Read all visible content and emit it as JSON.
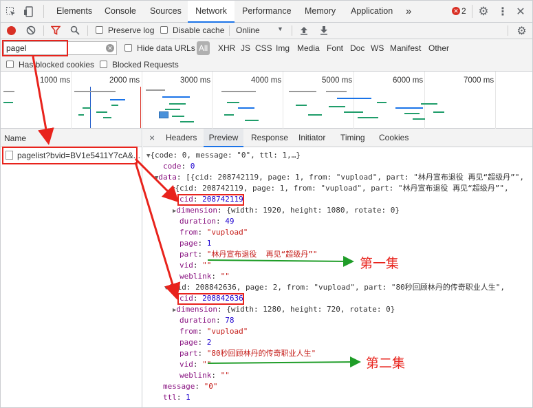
{
  "tabs": {
    "elements": "Elements",
    "console": "Console",
    "sources": "Sources",
    "network": "Network",
    "performance": "Performance",
    "memory": "Memory",
    "application": "Application",
    "more": "»",
    "error_count": "2"
  },
  "toolbar": {
    "preserve_log": "Preserve log",
    "disable_cache": "Disable cache",
    "throttle": "Online"
  },
  "filter": {
    "value": "pagel",
    "hide_data_urls": "Hide data URLs",
    "types": [
      "All",
      "XHR",
      "JS",
      "CSS",
      "Img",
      "Media",
      "Font",
      "Doc",
      "WS",
      "Manifest",
      "Other"
    ],
    "has_blocked_cookies": "Has blocked cookies",
    "blocked_requests": "Blocked Requests"
  },
  "timeline": {
    "ticks": [
      "1000 ms",
      "2000 ms",
      "3000 ms",
      "4000 ms",
      "5000 ms",
      "6000 ms",
      "7000 ms"
    ]
  },
  "requests": {
    "name_header": "Name",
    "items": [
      "pagelist?bvid=BV1e5411Y7cA&..."
    ]
  },
  "detail_tabs": {
    "close": "×",
    "headers": "Headers",
    "preview": "Preview",
    "response": "Response",
    "initiator": "Initiator",
    "timing": "Timing",
    "cookies": "Cookies"
  },
  "preview": {
    "root": "{code: 0, message: \"0\", ttl: 1,…}",
    "code_key": "code",
    "code_val": "0",
    "data_key": "data",
    "data_summary": "[{cid: 208742119, page: 1, from: \"vupload\", part: \"林丹宣布退役 再见“超级丹”\",",
    "item0_summary": "{cid: 208742119, page: 1, from: \"vupload\", part: \"林丹宣布退役 再见“超级丹”\", ",
    "item0": {
      "cid_key": "cid",
      "cid_val": "208742119",
      "dimension_key": "dimension",
      "dimension_val": "{width: 1920, height: 1080, rotate: 0}",
      "duration_key": "duration",
      "duration_val": "49",
      "from_key": "from",
      "from_val": "\"vupload\"",
      "page_key": "page",
      "page_val": "1",
      "part_key": "part",
      "part_val": "\"林丹宣布退役  再见“超级丹”\"",
      "vid_key": "vid",
      "vid_val": "\"\"",
      "weblink_key": "weblink",
      "weblink_val": "\"\""
    },
    "item1_summary": "{cid: 208842636, page: 2, from: \"vupload\", part: \"80秒回顾林丹的传奇职业人生\",",
    "item1": {
      "cid_key": "cid",
      "cid_val": "208842636",
      "dimension_key": "dimension",
      "dimension_val": "{width: 1280, height: 720, rotate: 0}",
      "duration_key": "duration",
      "duration_val": "78",
      "from_key": "from",
      "from_val": "\"vupload\"",
      "page_key": "page",
      "page_val": "2",
      "part_key": "part",
      "part_val": "\"80秒回顾林丹的传奇职业人生\"",
      "vid_key": "vid",
      "vid_val": "\"\"",
      "weblink_key": "weblink",
      "weblink_val": "\"\""
    },
    "message_key": "message",
    "message_val": "\"0\"",
    "ttl_key": "ttl",
    "ttl_val": "1"
  },
  "annotations": {
    "episode1": "第一集",
    "episode2": "第二集"
  },
  "colors": {
    "accent": "#1a73e8",
    "annotation_red": "#e8231c",
    "annotation_green": "#1f9d28",
    "record_red": "#d93025",
    "json_key": "#881280",
    "json_number": "#1c00cf",
    "json_string": "#c41a16"
  }
}
